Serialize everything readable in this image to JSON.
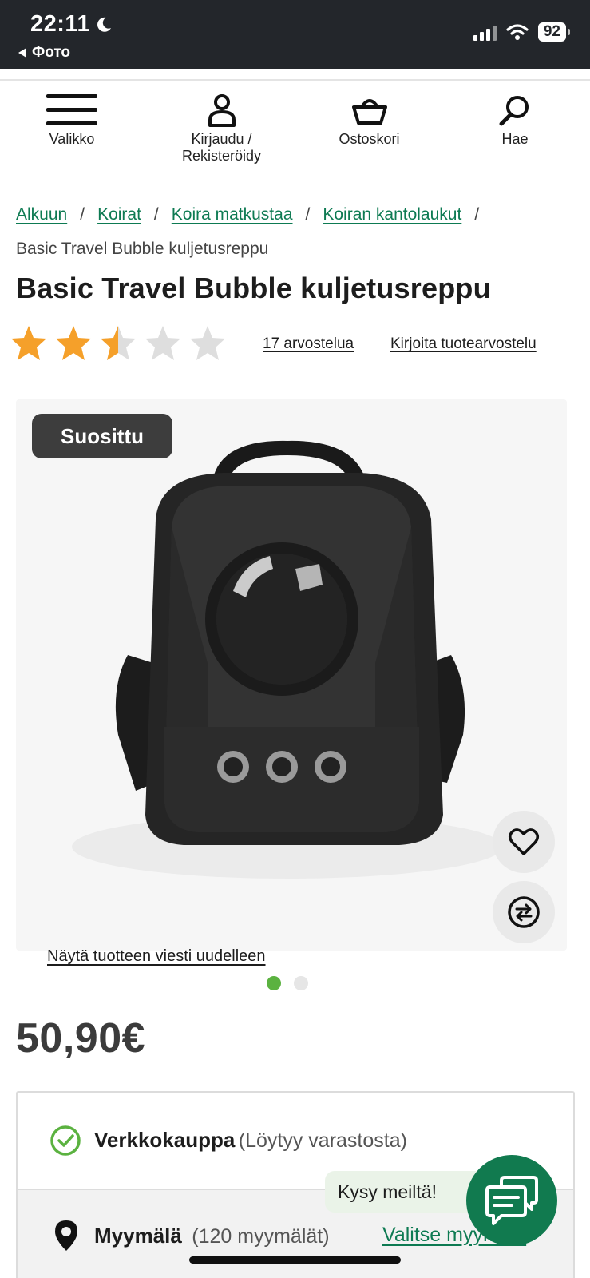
{
  "status_bar": {
    "time": "22:11",
    "back_label": "Фото",
    "battery": "92"
  },
  "nav": {
    "menu_label": "Valikko",
    "login_label_1": "Kirjaudu /",
    "login_label_2": "Rekisteröidy",
    "cart_label": "Ostoskori",
    "search_label": "Hae"
  },
  "breadcrumb": {
    "items": [
      "Alkuun",
      "Koirat",
      "Koira matkustaa",
      "Koiran kantolaukut"
    ],
    "separator": "/",
    "current": "Basic Travel Bubble kuljetusreppu"
  },
  "product": {
    "title": "Basic Travel Bubble kuljetusreppu",
    "rating": 2.5,
    "rating_max": 5,
    "reviews_link": "17 arvostelua",
    "write_review_link": "Kirjoita tuotearvostelu",
    "badge": "Suosittu",
    "show_message_link": "Näytä tuotteen viesti uudelleen",
    "image_count": 2,
    "active_image": 1,
    "price": "50,90€"
  },
  "availability": {
    "online_title": "Verkkokauppa",
    "online_status": "(Löytyy varastosta)",
    "store_title": "Myymälä",
    "store_count": "(120 myymälät)",
    "choose_store_link": "Valitse myymälä"
  },
  "chat": {
    "bubble_label": "Kysy meiltä!"
  },
  "colors": {
    "accent_green": "#0d7a52",
    "star_orange": "#f5a02a",
    "dot_green": "#5bb240"
  }
}
